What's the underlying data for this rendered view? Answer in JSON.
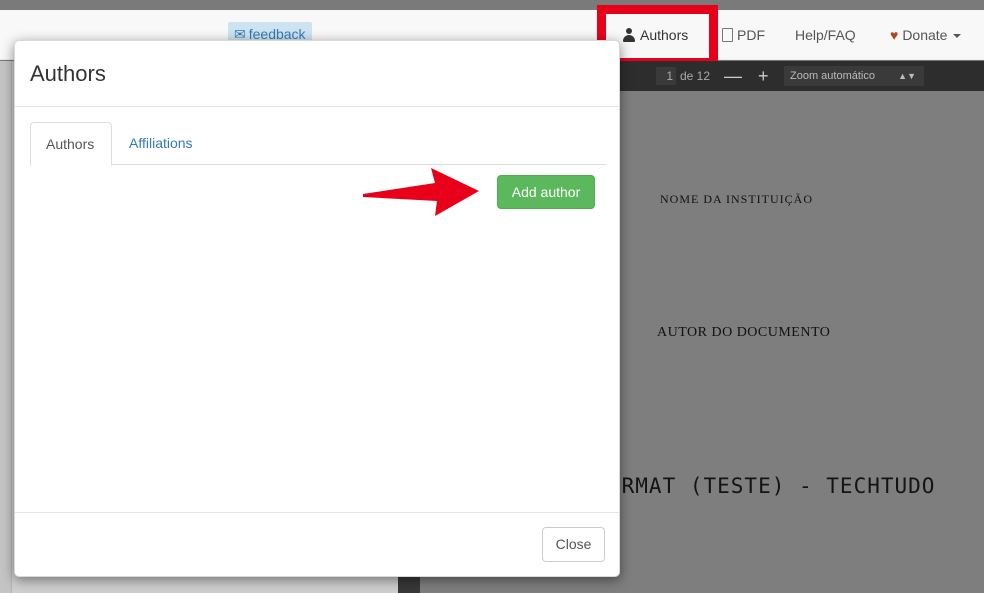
{
  "navbar": {
    "feedback_label": "feedback",
    "authors_label": "Authors",
    "pdf_label": "PDF",
    "help_label": "Help/FAQ",
    "donate_label": "Donate"
  },
  "pdf_viewer": {
    "page_number": "1",
    "page_of": "de 12",
    "zoom_minus": "—",
    "zoom_plus": "+",
    "zoom_value": "Zoom automático",
    "lines": {
      "institution": "NOME DA INSTITUIÇÃO",
      "author": "AUTOR DO DOCUMENTO",
      "title": "ORMAT (TESTE) - TECHTUDO"
    }
  },
  "modal": {
    "title": "Authors",
    "tabs": [
      {
        "label": "Authors",
        "active": true
      },
      {
        "label": "Affiliations",
        "active": false
      }
    ],
    "add_author_label": "Add author",
    "close_label": "Close"
  },
  "colors": {
    "highlight": "#e8001a",
    "add_button": "#5cb85c",
    "link": "#337ab7"
  },
  "icons": {
    "feedback": "envelope-icon",
    "authors": "user-icon",
    "pdf": "pdf-file-icon",
    "donate": "heart-icon",
    "annotation": "red-arrow-icon"
  }
}
